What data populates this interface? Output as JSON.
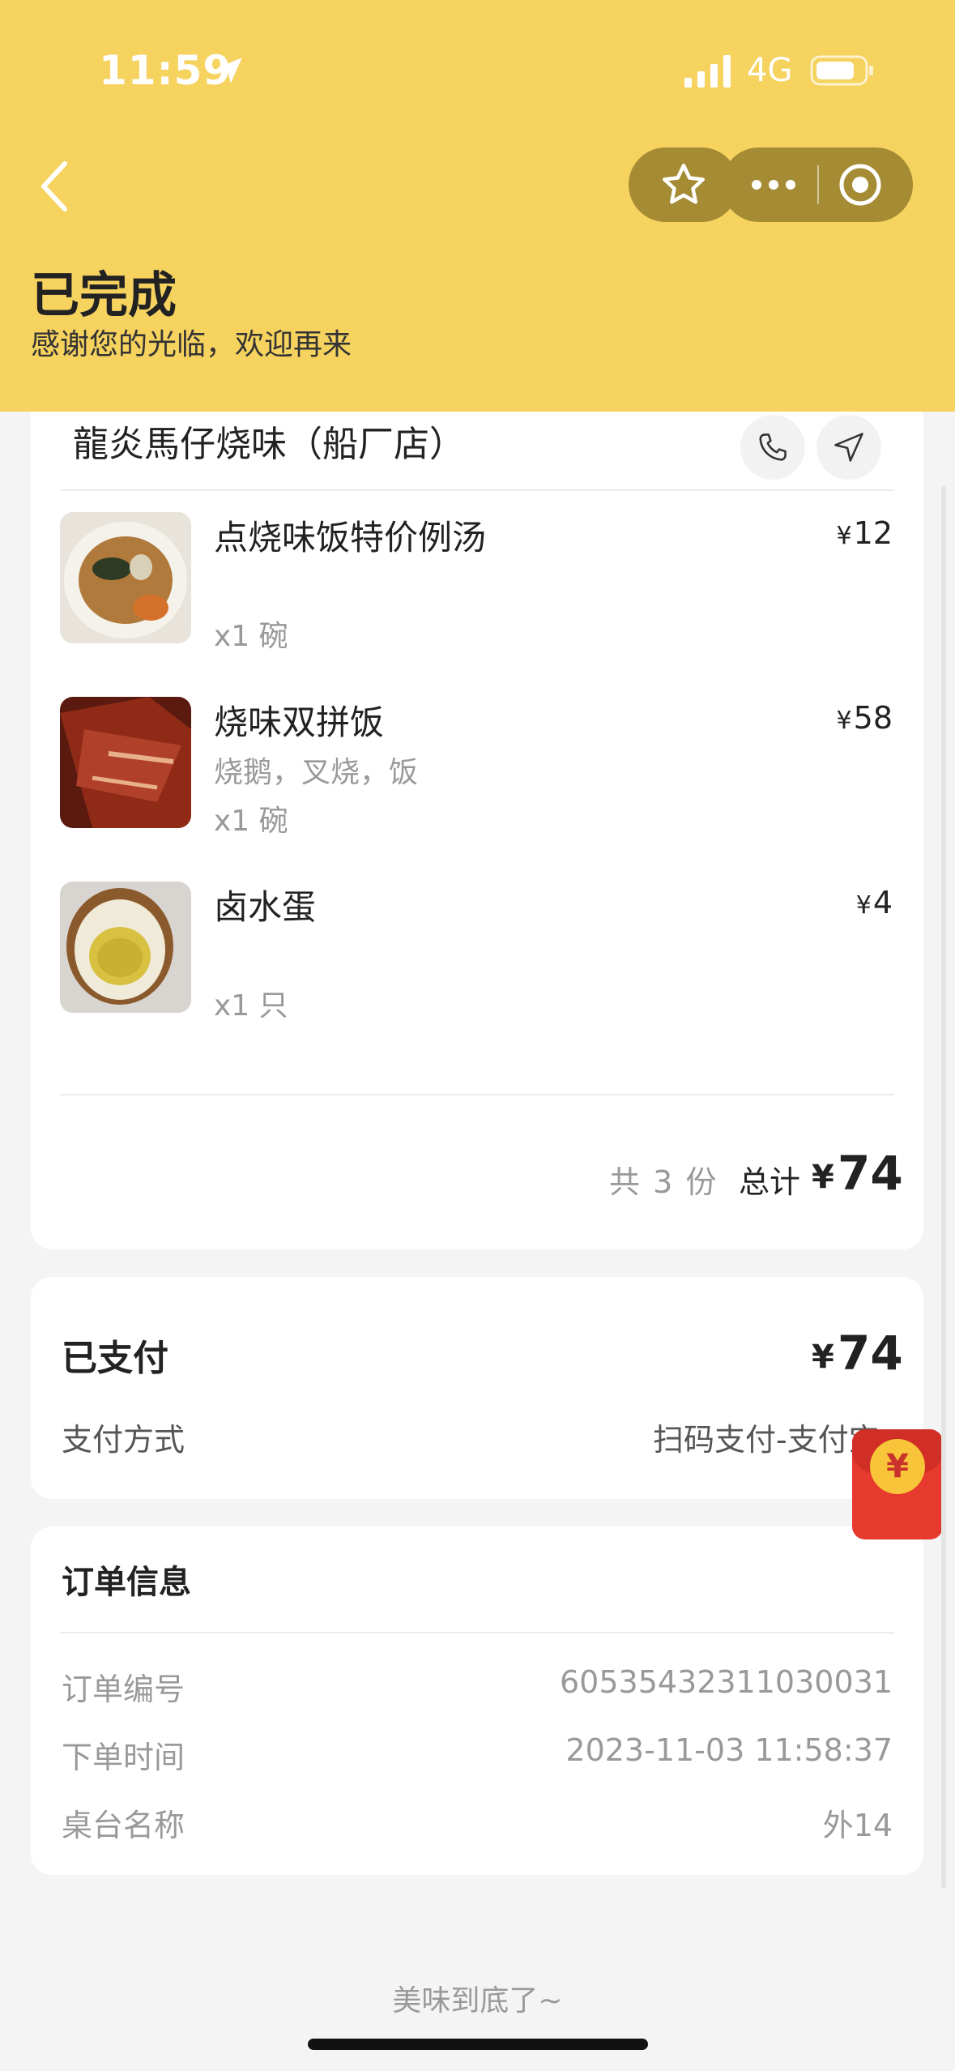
{
  "status_bar": {
    "time": "11:59",
    "network": "4G"
  },
  "header": {
    "title": "已完成",
    "subtitle": "感谢您的光临，欢迎再来"
  },
  "shop": {
    "name": "龍炎馬仔烧味（船厂店）"
  },
  "items": [
    {
      "name": "点烧味饭特价例汤",
      "desc": "",
      "qty": "x1 碗",
      "currency": "¥",
      "price": "12"
    },
    {
      "name": "烧味双拼饭",
      "desc": "烧鹅，叉烧，饭",
      "qty": "x1 碗",
      "currency": "¥",
      "price": "58"
    },
    {
      "name": "卤水蛋",
      "desc": "",
      "qty": "x1 只",
      "currency": "¥",
      "price": "4"
    }
  ],
  "summary": {
    "count_text": "共 3 份",
    "total_label": "总计",
    "currency": "¥",
    "total": "74"
  },
  "payment": {
    "status": "已支付",
    "currency": "¥",
    "amount": "74",
    "method_label": "支付方式",
    "method_value": "扫码支付-支付宝"
  },
  "order_info": {
    "title": "订单信息",
    "rows": [
      {
        "label": "订单编号",
        "value": "60535432311030031"
      },
      {
        "label": "下单时间",
        "value": "2023-11-03 11:58:37"
      },
      {
        "label": "桌台名称",
        "value": "外14"
      }
    ]
  },
  "red_packet": {
    "symbol": "¥"
  },
  "footer": {
    "text": "美味到底了~"
  },
  "colors": {
    "header_bg": "#f6d25f",
    "capsule_bg": "#a48b34",
    "page_bg": "#f4f4f4",
    "red_packet": "#e63a2e"
  }
}
